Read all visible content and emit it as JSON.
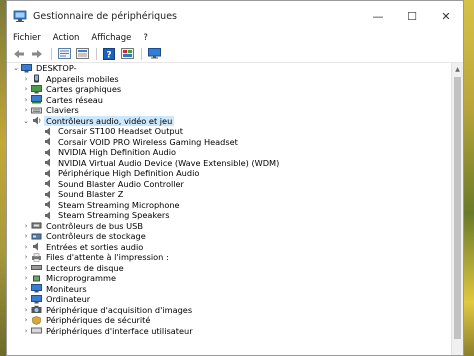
{
  "window": {
    "title": "Gestionnaire de périphériques",
    "controls": {
      "minimize": "—",
      "maximize": "☐",
      "close": "✕"
    }
  },
  "menu": [
    "Fichier",
    "Action",
    "Affichage",
    "?"
  ],
  "toolbar": {
    "buttons": [
      "back-arrow-icon",
      "forward-arrow-icon",
      "properties-icon",
      "update-driver-icon",
      "help-icon",
      "show-hidden-icon",
      "monitor-icon"
    ]
  },
  "tree": {
    "root": {
      "label": "DESKTOP-",
      "icon": "computer-icon"
    },
    "categories": [
      {
        "label": "Appareils mobiles",
        "icon": "mobile-device-icon"
      },
      {
        "label": "Cartes graphiques",
        "icon": "display-adapter-icon"
      },
      {
        "label": "Cartes réseau",
        "icon": "network-adapter-icon"
      },
      {
        "label": "Claviers",
        "icon": "keyboard-icon"
      },
      {
        "label": "Contrôleurs audio, vidéo et jeu",
        "icon": "audio-controller-icon",
        "expanded": true,
        "selected": true,
        "children": [
          "Corsair ST100 Headset Output",
          "Corsair VOID PRO Wireless Gaming Headset",
          "NVIDIA High Definition Audio",
          "NVIDIA Virtual Audio Device (Wave Extensible) (WDM)",
          "Périphérique High Definition Audio",
          "Sound Blaster Audio Controller",
          "Sound Blaster Z",
          "Steam Streaming Microphone",
          "Steam Streaming Speakers"
        ]
      },
      {
        "label": "Contrôleurs de bus USB",
        "icon": "usb-controller-icon"
      },
      {
        "label": "Contrôleurs de stockage",
        "icon": "storage-controller-icon"
      },
      {
        "label": "Entrées et sorties audio",
        "icon": "audio-io-icon"
      },
      {
        "label": "Files d'attente à l'impression :",
        "icon": "print-queue-icon"
      },
      {
        "label": "Lecteurs de disque",
        "icon": "disk-drive-icon"
      },
      {
        "label": "Microprogramme",
        "icon": "firmware-icon"
      },
      {
        "label": "Moniteurs",
        "icon": "monitor-icon"
      },
      {
        "label": "Ordinateur",
        "icon": "computer-icon"
      },
      {
        "label": "Périphérique d'acquisition d'images",
        "icon": "imaging-device-icon"
      },
      {
        "label": "Périphériques de sécurité",
        "icon": "security-device-icon"
      },
      {
        "label": "Périphériques d'interface utilisateur",
        "icon": "hid-icon"
      }
    ]
  },
  "colors": {
    "selection": "#cce8ff",
    "accent": "#1e6fc8"
  }
}
